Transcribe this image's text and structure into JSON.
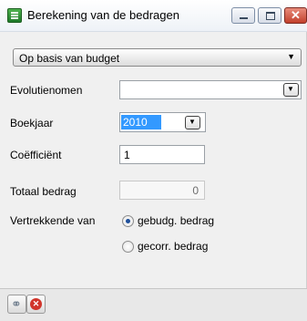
{
  "window": {
    "title": "Berekening van de bedragen"
  },
  "basis": {
    "selected": "Op basis van budget"
  },
  "fields": {
    "evolution_label": "Evolutienomen",
    "evolution_value": "",
    "year_label": "Boekjaar",
    "year_value": "2010",
    "coefficient_label": "Coëfficiënt",
    "coefficient_value": "1",
    "total_label": "Totaal bedrag",
    "total_value": "0"
  },
  "start_from": {
    "label": "Vertrekkende van",
    "options": [
      "gebudg. bedrag",
      "gecorr. bedrag"
    ],
    "selected": "gebudg. bedrag"
  },
  "footer": {
    "icons": [
      "link-icon",
      "cancel-icon"
    ]
  }
}
